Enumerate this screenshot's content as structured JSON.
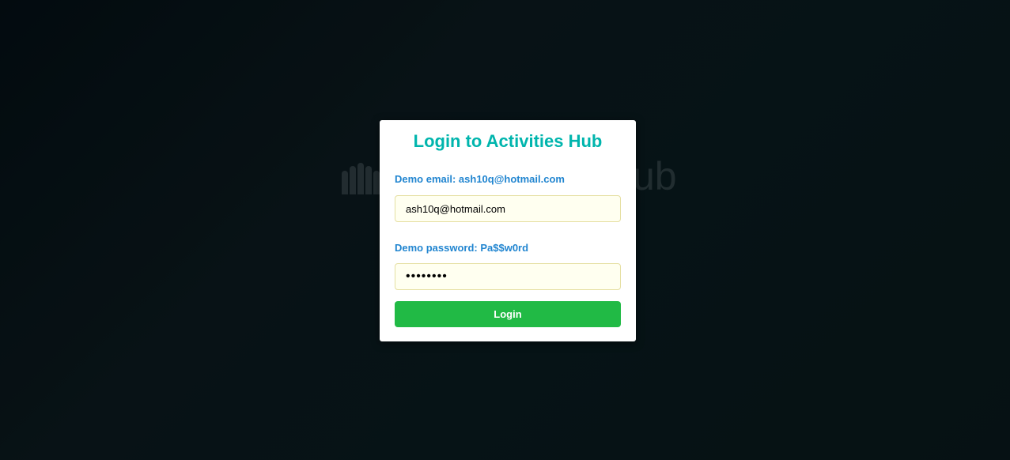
{
  "modal": {
    "title": "Login to Activities Hub",
    "email_hint": "Demo email: ash10q@hotmail.com",
    "email_value": "ash10q@hotmail.com",
    "password_hint": "Demo password: Pa$$w0rd",
    "password_value": "Pa$$w0rd",
    "login_label": "Login"
  },
  "background": {
    "logo_icon": "people-group-icon",
    "logo_text": "ub"
  },
  "colors": {
    "title": "#00b5ad",
    "hint": "#2185d0",
    "login_button": "#21ba45",
    "input_background": "#fffff0"
  }
}
